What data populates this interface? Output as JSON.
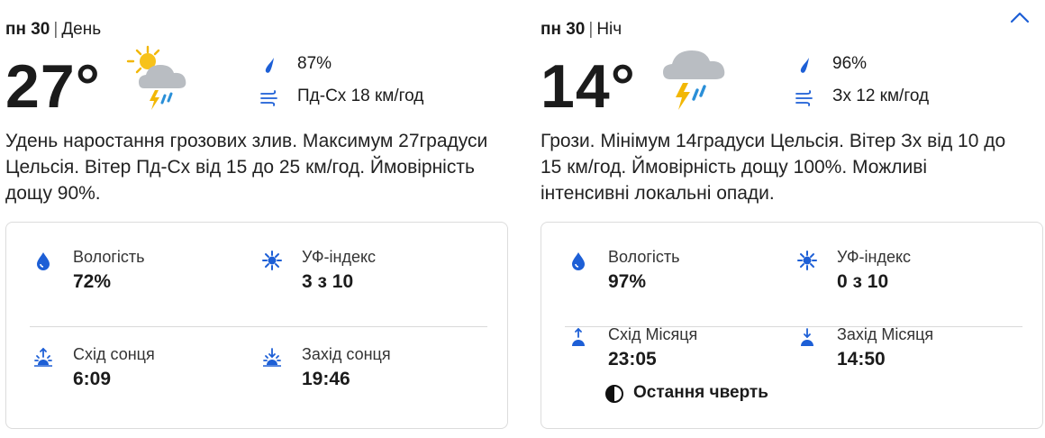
{
  "day": {
    "weekday": "пн 30",
    "separator": "|",
    "period": "День",
    "temperature": "27°",
    "weather_icon": "sun-cloud-thunderstorm-icon",
    "precip_prob": "87%",
    "wind": "Пд-Сх 18 км/год",
    "summary": "Удень наростання грозових злив. Максимум 27градуси Цельсія. Вітер Пд-Сх від 15 до 25 км/год. Ймовірність дощу 90%.",
    "details": {
      "humidity_label": "Вологість",
      "humidity_value": "72%",
      "uv_label": "УФ-індекс",
      "uv_value": "3 з 10",
      "sunrise_label": "Схід сонця",
      "sunrise_value": "6:09",
      "sunset_label": "Захід сонця",
      "sunset_value": "19:46"
    }
  },
  "night": {
    "weekday": "пн 30",
    "separator": "|",
    "period": "Ніч",
    "temperature": "14°",
    "weather_icon": "cloud-thunderstorm-icon",
    "precip_prob": "96%",
    "wind": "Зх 12 км/год",
    "summary": "Грози. Мінімум 14градуси Цельсія. Вітер Зх від 10 до 15 км/год. Ймовірність дощу 100%. Можливі інтенсивні локальні опади.",
    "details": {
      "humidity_label": "Вологість",
      "humidity_value": "97%",
      "uv_label": "УФ-індекс",
      "uv_value": "0 з 10",
      "moonrise_label": "Схід Місяця",
      "moonrise_value": "23:05",
      "moonset_label": "Захід Місяця",
      "moonset_value": "14:50",
      "moon_phase": "Остання чверть"
    }
  },
  "colors": {
    "accent": "#1d5fd6",
    "text": "#1b1b1b",
    "border": "#dcdcdc"
  }
}
